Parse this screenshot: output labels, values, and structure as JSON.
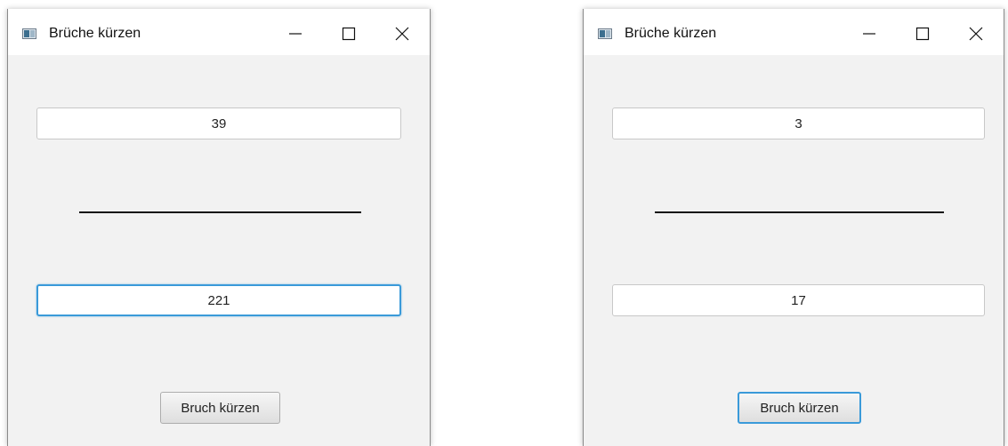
{
  "windows": [
    {
      "title": "Brüche kürzen",
      "numerator": "39",
      "denominator": "221",
      "button_label": "Bruch kürzen",
      "focused": "denominator-field"
    },
    {
      "title": "Brüche kürzen",
      "numerator": "3",
      "denominator": "17",
      "button_label": "Bruch kürzen",
      "focused": "reduce-button"
    }
  ],
  "icons": {
    "app": "app-window-icon",
    "minimize": "minimize-icon",
    "maximize": "maximize-icon",
    "close": "close-icon"
  },
  "colors": {
    "focus_ring": "#3a9ad9",
    "window_background": "#f2f2f2",
    "titlebar": "#ffffff"
  }
}
